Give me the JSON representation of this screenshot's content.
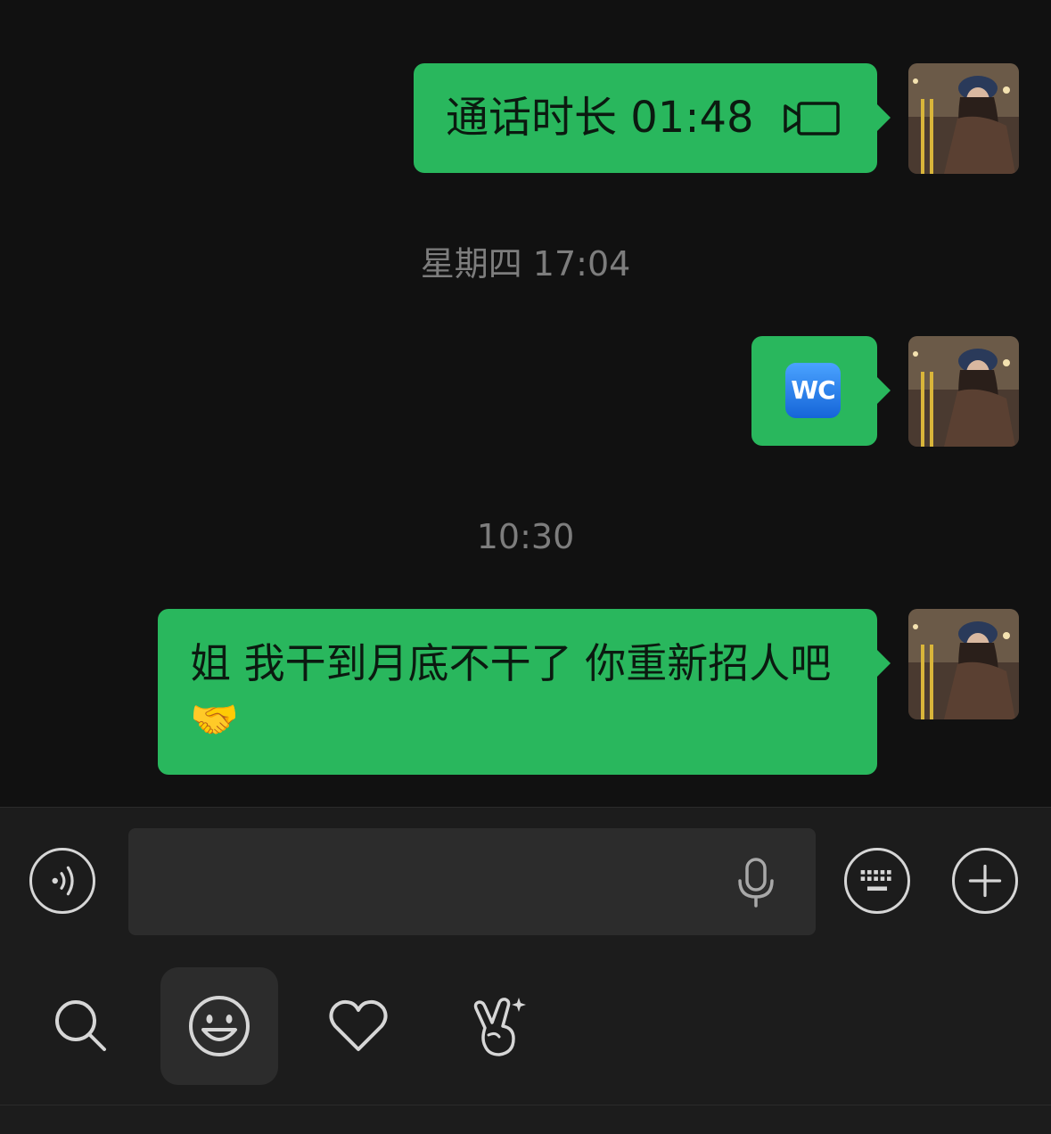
{
  "chat": {
    "timestamps": [
      "星期四 17:04",
      "10:30"
    ],
    "call_message": {
      "text": "通话时长 01:48",
      "icon": "video-call-icon"
    },
    "wc_message": {
      "text": "WC",
      "icon": "wc-emoji"
    },
    "text_message": {
      "text": "姐 我干到月底不干了 你重新招人吧",
      "emoji": "🤝"
    },
    "avatar": "user-avatar"
  },
  "input_bar": {
    "voice_icon": "voice-toggle-icon",
    "input_value": "",
    "mic_icon": "microphone-icon",
    "keyboard_icon": "keyboard-icon",
    "plus_icon": "plus-icon"
  },
  "emoji_panel": {
    "tabs": [
      "search-icon",
      "smiley-icon",
      "heart-icon",
      "victory-hand-icon"
    ],
    "active_tab": "smiley-icon"
  },
  "colors": {
    "background": "#111111",
    "bubble": "#29b75d",
    "panel": "#1c1c1c",
    "timestamp": "#7d7d7d"
  }
}
